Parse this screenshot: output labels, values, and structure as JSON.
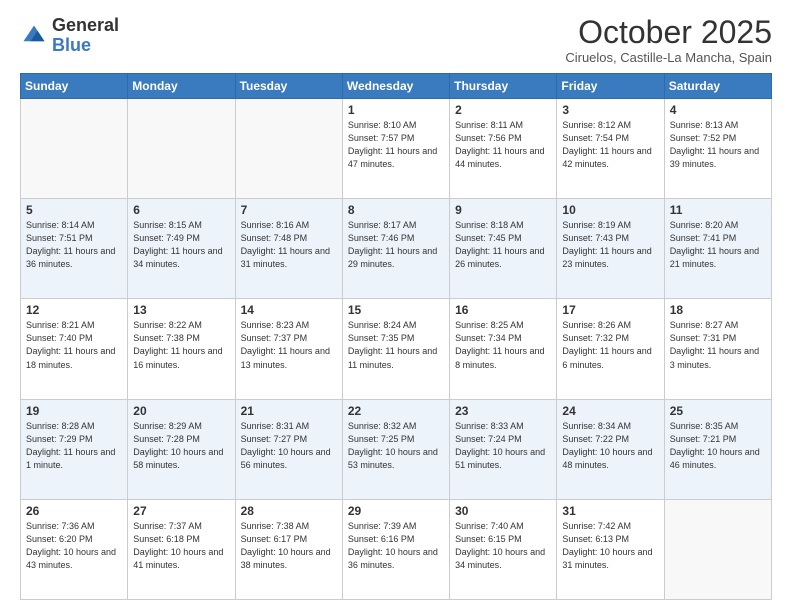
{
  "header": {
    "logo_general": "General",
    "logo_blue": "Blue",
    "month_title": "October 2025",
    "location": "Ciruelos, Castille-La Mancha, Spain"
  },
  "days_of_week": [
    "Sunday",
    "Monday",
    "Tuesday",
    "Wednesday",
    "Thursday",
    "Friday",
    "Saturday"
  ],
  "weeks": [
    [
      {
        "day": "",
        "sunrise": "",
        "sunset": "",
        "daylight": ""
      },
      {
        "day": "",
        "sunrise": "",
        "sunset": "",
        "daylight": ""
      },
      {
        "day": "",
        "sunrise": "",
        "sunset": "",
        "daylight": ""
      },
      {
        "day": "1",
        "sunrise": "Sunrise: 8:10 AM",
        "sunset": "Sunset: 7:57 PM",
        "daylight": "Daylight: 11 hours and 47 minutes."
      },
      {
        "day": "2",
        "sunrise": "Sunrise: 8:11 AM",
        "sunset": "Sunset: 7:56 PM",
        "daylight": "Daylight: 11 hours and 44 minutes."
      },
      {
        "day": "3",
        "sunrise": "Sunrise: 8:12 AM",
        "sunset": "Sunset: 7:54 PM",
        "daylight": "Daylight: 11 hours and 42 minutes."
      },
      {
        "day": "4",
        "sunrise": "Sunrise: 8:13 AM",
        "sunset": "Sunset: 7:52 PM",
        "daylight": "Daylight: 11 hours and 39 minutes."
      }
    ],
    [
      {
        "day": "5",
        "sunrise": "Sunrise: 8:14 AM",
        "sunset": "Sunset: 7:51 PM",
        "daylight": "Daylight: 11 hours and 36 minutes."
      },
      {
        "day": "6",
        "sunrise": "Sunrise: 8:15 AM",
        "sunset": "Sunset: 7:49 PM",
        "daylight": "Daylight: 11 hours and 34 minutes."
      },
      {
        "day": "7",
        "sunrise": "Sunrise: 8:16 AM",
        "sunset": "Sunset: 7:48 PM",
        "daylight": "Daylight: 11 hours and 31 minutes."
      },
      {
        "day": "8",
        "sunrise": "Sunrise: 8:17 AM",
        "sunset": "Sunset: 7:46 PM",
        "daylight": "Daylight: 11 hours and 29 minutes."
      },
      {
        "day": "9",
        "sunrise": "Sunrise: 8:18 AM",
        "sunset": "Sunset: 7:45 PM",
        "daylight": "Daylight: 11 hours and 26 minutes."
      },
      {
        "day": "10",
        "sunrise": "Sunrise: 8:19 AM",
        "sunset": "Sunset: 7:43 PM",
        "daylight": "Daylight: 11 hours and 23 minutes."
      },
      {
        "day": "11",
        "sunrise": "Sunrise: 8:20 AM",
        "sunset": "Sunset: 7:41 PM",
        "daylight": "Daylight: 11 hours and 21 minutes."
      }
    ],
    [
      {
        "day": "12",
        "sunrise": "Sunrise: 8:21 AM",
        "sunset": "Sunset: 7:40 PM",
        "daylight": "Daylight: 11 hours and 18 minutes."
      },
      {
        "day": "13",
        "sunrise": "Sunrise: 8:22 AM",
        "sunset": "Sunset: 7:38 PM",
        "daylight": "Daylight: 11 hours and 16 minutes."
      },
      {
        "day": "14",
        "sunrise": "Sunrise: 8:23 AM",
        "sunset": "Sunset: 7:37 PM",
        "daylight": "Daylight: 11 hours and 13 minutes."
      },
      {
        "day": "15",
        "sunrise": "Sunrise: 8:24 AM",
        "sunset": "Sunset: 7:35 PM",
        "daylight": "Daylight: 11 hours and 11 minutes."
      },
      {
        "day": "16",
        "sunrise": "Sunrise: 8:25 AM",
        "sunset": "Sunset: 7:34 PM",
        "daylight": "Daylight: 11 hours and 8 minutes."
      },
      {
        "day": "17",
        "sunrise": "Sunrise: 8:26 AM",
        "sunset": "Sunset: 7:32 PM",
        "daylight": "Daylight: 11 hours and 6 minutes."
      },
      {
        "day": "18",
        "sunrise": "Sunrise: 8:27 AM",
        "sunset": "Sunset: 7:31 PM",
        "daylight": "Daylight: 11 hours and 3 minutes."
      }
    ],
    [
      {
        "day": "19",
        "sunrise": "Sunrise: 8:28 AM",
        "sunset": "Sunset: 7:29 PM",
        "daylight": "Daylight: 11 hours and 1 minute."
      },
      {
        "day": "20",
        "sunrise": "Sunrise: 8:29 AM",
        "sunset": "Sunset: 7:28 PM",
        "daylight": "Daylight: 10 hours and 58 minutes."
      },
      {
        "day": "21",
        "sunrise": "Sunrise: 8:31 AM",
        "sunset": "Sunset: 7:27 PM",
        "daylight": "Daylight: 10 hours and 56 minutes."
      },
      {
        "day": "22",
        "sunrise": "Sunrise: 8:32 AM",
        "sunset": "Sunset: 7:25 PM",
        "daylight": "Daylight: 10 hours and 53 minutes."
      },
      {
        "day": "23",
        "sunrise": "Sunrise: 8:33 AM",
        "sunset": "Sunset: 7:24 PM",
        "daylight": "Daylight: 10 hours and 51 minutes."
      },
      {
        "day": "24",
        "sunrise": "Sunrise: 8:34 AM",
        "sunset": "Sunset: 7:22 PM",
        "daylight": "Daylight: 10 hours and 48 minutes."
      },
      {
        "day": "25",
        "sunrise": "Sunrise: 8:35 AM",
        "sunset": "Sunset: 7:21 PM",
        "daylight": "Daylight: 10 hours and 46 minutes."
      }
    ],
    [
      {
        "day": "26",
        "sunrise": "Sunrise: 7:36 AM",
        "sunset": "Sunset: 6:20 PM",
        "daylight": "Daylight: 10 hours and 43 minutes."
      },
      {
        "day": "27",
        "sunrise": "Sunrise: 7:37 AM",
        "sunset": "Sunset: 6:18 PM",
        "daylight": "Daylight: 10 hours and 41 minutes."
      },
      {
        "day": "28",
        "sunrise": "Sunrise: 7:38 AM",
        "sunset": "Sunset: 6:17 PM",
        "daylight": "Daylight: 10 hours and 38 minutes."
      },
      {
        "day": "29",
        "sunrise": "Sunrise: 7:39 AM",
        "sunset": "Sunset: 6:16 PM",
        "daylight": "Daylight: 10 hours and 36 minutes."
      },
      {
        "day": "30",
        "sunrise": "Sunrise: 7:40 AM",
        "sunset": "Sunset: 6:15 PM",
        "daylight": "Daylight: 10 hours and 34 minutes."
      },
      {
        "day": "31",
        "sunrise": "Sunrise: 7:42 AM",
        "sunset": "Sunset: 6:13 PM",
        "daylight": "Daylight: 10 hours and 31 minutes."
      },
      {
        "day": "",
        "sunrise": "",
        "sunset": "",
        "daylight": ""
      }
    ]
  ]
}
